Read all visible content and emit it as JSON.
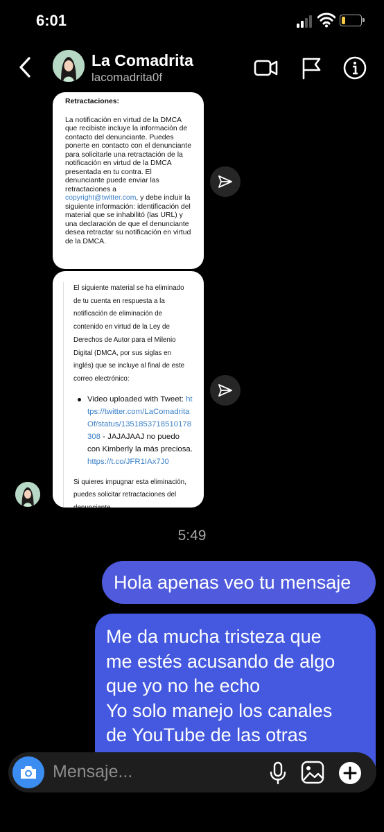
{
  "status_bar": {
    "time": "6:01",
    "signal_bars_active": 2,
    "signal_bars_total": 4,
    "battery_level": 0.2,
    "battery_color": "#f7c844"
  },
  "header": {
    "back_icon": "chevron-left-icon",
    "contact_name": "La Comadrita",
    "contact_username": "lacomadrita0f",
    "icons": [
      "video-camera-icon",
      "flag-icon",
      "info-icon"
    ]
  },
  "messages": {
    "card1": {
      "heading": "Retractaciones:",
      "para1": "La notificación en virtud de la DMCA que recibiste incluye la información de contacto del denunciante. Puedes ponerte en contacto con el denunciante para solicitarle una retractación de la notificación en virtud de la DMCA presentada en tu contra. El denunciante puede enviar las retractaciones a",
      "email": "copyright@twitter.com",
      "para2": ", y debe incluir la siguiente información: identificación del material que se inhabilitó (las URL) y una declaración de que el denunciante desea retractar su notificación en virtud de la DMCA."
    },
    "card2": {
      "intro": "El siguiente material se ha eliminado de tu cuenta en respuesta a la notificación de eliminación de contenido en virtud de la Ley de Derechos de Autor para el Milenio Digital (DMCA, por sus siglas en inglés) que se incluye al final de este correo electrónico:",
      "bullet_label": "Video uploaded with Tweet:",
      "tweet_url": "https://twitter.com/LaComadritaOf/status/1351853718510178308",
      "bullet_sep": " - ",
      "tweet_text": "JAJAJAAJ no puedo con Kimberly la más preciosa.",
      "short_url": "https://t.co/JFR1IAx7J0",
      "outro": "Si quieres impugnar esta eliminación, puedes solicitar retractaciones del denunciante"
    },
    "timestamp": "5:49",
    "sent": [
      "Hola apenas veo tu  mensaje",
      "Me da mucha tristeza que\nme estés acusando de algo\nque yo no he echo\nYo  solo manejo los canales\nde YouTube de las otras"
    ],
    "sent_colors": [
      "#4f5bdc",
      "#4459df"
    ]
  },
  "composer": {
    "placeholder": "Mensaje...",
    "icons": [
      "camera-icon",
      "microphone-icon",
      "gallery-icon",
      "plus-icon"
    ],
    "camera_color": "#3c8df2"
  }
}
